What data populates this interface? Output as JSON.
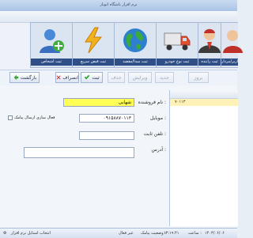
{
  "window": {
    "title": "نرم افزار باشگاه اتوبار"
  },
  "ribbon": {
    "items": [
      {
        "label": "ثبت اشخاص",
        "icon": "person-add-icon"
      },
      {
        "label": "ثبت قبض سریع",
        "icon": "lightning-icon"
      },
      {
        "label": "ثبت مبدا/مقصد",
        "icon": "globe-icon"
      },
      {
        "label": "ثبت نوع خودرو",
        "icon": "truck-icon"
      },
      {
        "label": "ثبت راننده",
        "icon": "driver-icon"
      },
      {
        "label": "کاربر/مردار",
        "icon": "users-icon"
      }
    ]
  },
  "toolbar": {
    "return_label": "بازگشت",
    "cancel_label": "انصراف",
    "save_label": "ثبت",
    "delete_label": "حذف",
    "edit_label": "ویرایش",
    "new_label": "جدید",
    "refresh_label": "بروز"
  },
  "form": {
    "seller_name_label": "نام فروشنده :",
    "seller_name_value": "شهابی",
    "mobile_label": "موبایل :",
    "mobile_value": "۰۹۱۵۸۸۷۰۱۱۳",
    "sms_label": "فعال سازی ارسال پیامک",
    "landline_label": "تلفن ثابت :",
    "landline_value": "",
    "address_label": "آدرس :",
    "address_value": ""
  },
  "list": {
    "rows": [
      "۷۰۱۱۳"
    ]
  },
  "status": {
    "left": "انتخاب استایل نرم افزار",
    "sms_status_label": "وضعیت پیامک :",
    "sms_status_value": "غیر فعال",
    "time_label": "ساعت :",
    "time_value": "۱۳:۱۹:۴۱",
    "date_value": "۱۴۰۳/۰۶/۰۶"
  },
  "colors": {
    "highlight": "#ffff55",
    "ribbon_label_bg": "#2f4f86",
    "selected_row": "#fff2b8"
  }
}
